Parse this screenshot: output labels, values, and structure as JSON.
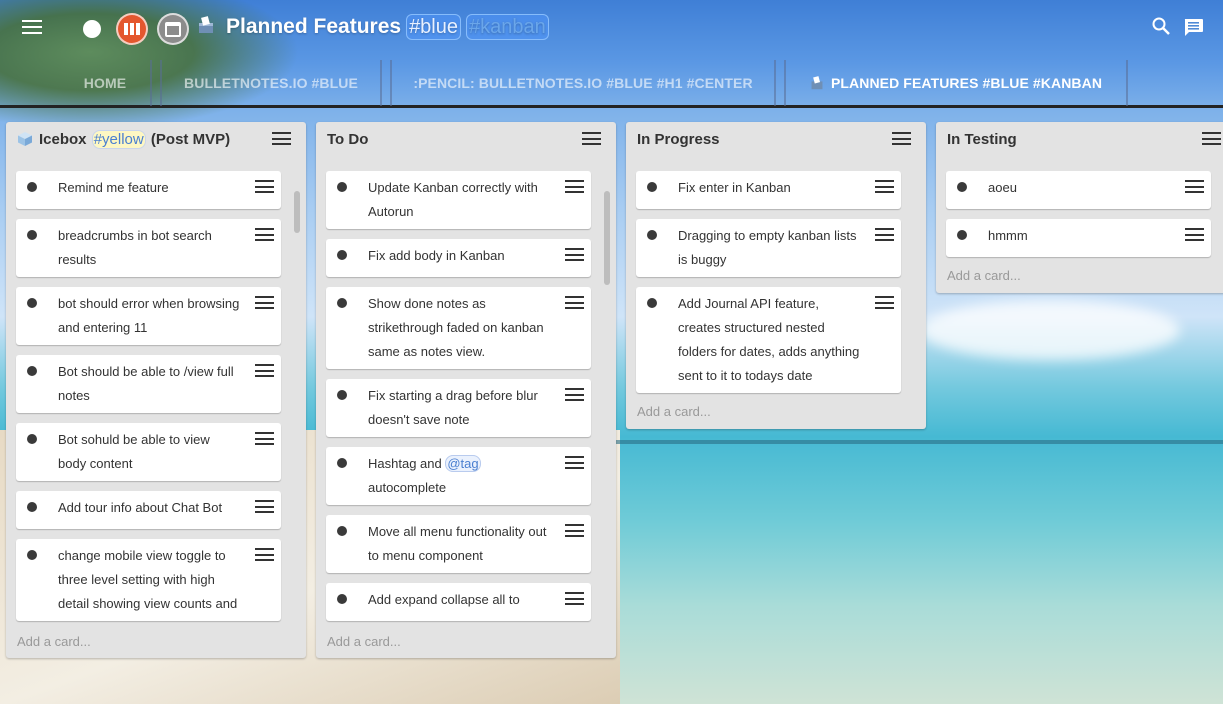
{
  "header": {
    "title": "Planned Features",
    "tags": [
      "#blue",
      "#kanban"
    ],
    "icons": [
      "menu-icon",
      "dot-icon",
      "kanban-view-icon",
      "calendar-icon",
      "search-icon",
      "chat-icon"
    ]
  },
  "tabs": [
    {
      "label": "HOME",
      "active": false
    },
    {
      "label": "BULLETNOTES.IO #BLUE",
      "active": false
    },
    {
      "label": ":PENCIL: BULLETNOTES.IO #BLUE #H1 #CENTER",
      "active": false
    },
    {
      "label": "PLANNED FEATURES #BLUE #KANBAN",
      "active": true
    }
  ],
  "lists": [
    {
      "title_before": "Icebox",
      "title_tag": "#yellow",
      "title_after": "(Post MVP)",
      "cards": [
        "Remind me feature",
        "breadcrumbs in bot search results",
        "bot should error when browsing and entering 11",
        "Bot should be able to /view full notes",
        "Bot sohuld be able to view body content",
        "Add tour info about Chat Bot",
        "change mobile view toggle to three level setting with high detail showing view counts and"
      ],
      "add_card": "Add a card..."
    },
    {
      "title": "To Do",
      "cards": [
        "Update Kanban correctly with Autorun",
        "Fix add body in Kanban",
        "Show done notes as strikethrough faded on kanban same as notes view.",
        "Fix starting a drag before blur doesn't save note",
        {
          "before": "Hashtag and ",
          "tag": "@tag",
          "after": " autocomplete"
        },
        "Move all menu functionality out to menu component",
        "Add expand collapse all to"
      ],
      "add_card": "Add a card..."
    },
    {
      "title": "In Progress",
      "cards": [
        "Fix enter in Kanban",
        "Dragging to empty kanban lists is buggy",
        "Add Journal API feature, creates structured nested folders for dates, adds anything sent to it to todays date"
      ],
      "add_card": "Add a card..."
    },
    {
      "title": "In Testing",
      "cards": [
        "aoeu",
        "hmmm"
      ],
      "add_card": "Add a card..."
    }
  ],
  "colors": {
    "kanban_button": "#e4572e",
    "tag_blue": "#4a7fd0",
    "list_bg": "#e3e3e3"
  }
}
